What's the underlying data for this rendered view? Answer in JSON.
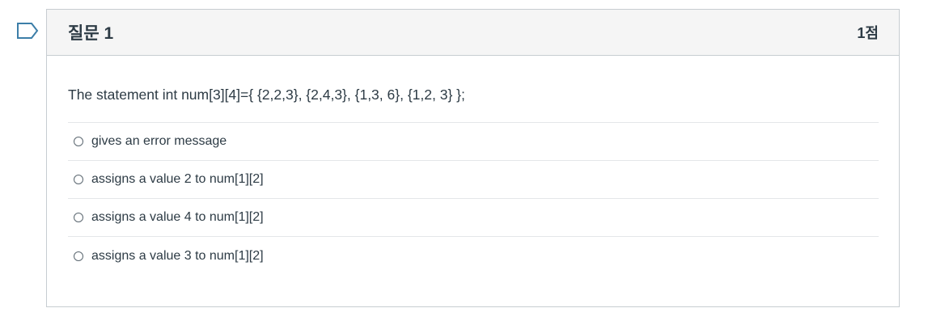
{
  "question": {
    "title": "질문 1",
    "points": "1점",
    "text": "The statement int num[3][4]={ {2,2,3}, {2,4,3}, {1,3, 6}, {1,2, 3} };",
    "answers": [
      {
        "label": "gives an error message"
      },
      {
        "label": "assigns a value 2 to num[1][2]"
      },
      {
        "label": "assigns a value 4 to num[1][2]"
      },
      {
        "label": "assigns a value 3 to num[1][2]"
      }
    ]
  },
  "icons": {
    "flag": "flag-question-icon",
    "radio": "radio-unchecked-icon"
  },
  "colors": {
    "header_bg": "#f5f5f5",
    "border": "#c7cdd1",
    "flag_stroke": "#3c7ea8",
    "text": "#2d3b45"
  }
}
